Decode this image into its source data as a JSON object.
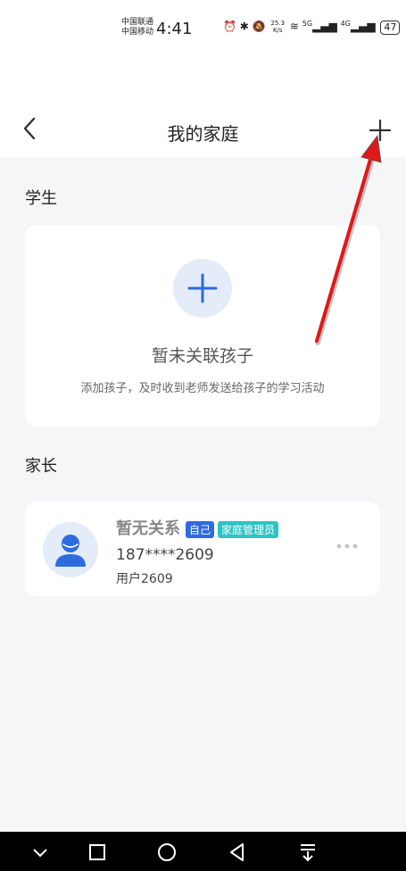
{
  "status_bar": {
    "carrier_1": "中国联通",
    "carrier_2": "中国移动",
    "time": "4:41",
    "net_speed_value": "25.3",
    "net_speed_unit": "K/s",
    "signal_1": "5G",
    "signal_2": "4G",
    "battery": "47"
  },
  "header": {
    "title": "我的家庭",
    "back_icon": "chevron-left-icon",
    "add_icon": "plus-icon"
  },
  "students": {
    "section_label": "学生",
    "empty_title": "暂未关联孩子",
    "empty_desc": "添加孩子，及时收到老师发送给孩子的学习活动"
  },
  "parents": {
    "section_label": "家长",
    "items": [
      {
        "name": "暂无关系",
        "tags": [
          "自己",
          "家庭管理员"
        ],
        "phone": "187****2609",
        "username": "用户2609"
      }
    ]
  },
  "colors": {
    "accent": "#2d6be0",
    "admin_tag": "#2ec4c4",
    "annotation_arrow": "#e01818"
  }
}
